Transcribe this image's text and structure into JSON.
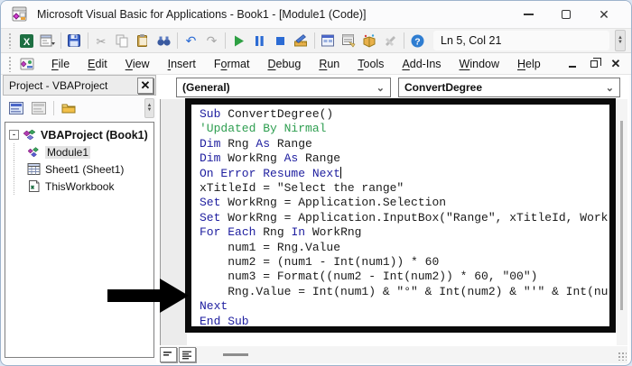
{
  "window": {
    "title": "Microsoft Visual Basic for Applications - Book1 - [Module1 (Code)]",
    "app_icon": "vba-app-icon",
    "controls": [
      "minimize",
      "maximize",
      "close"
    ]
  },
  "toolbar": {
    "icons": [
      "excel",
      "insert-userform",
      "save",
      "cut",
      "copy",
      "paste",
      "find",
      "undo",
      "redo",
      "run",
      "break",
      "reset",
      "design-mode",
      "project-explorer",
      "properties-window",
      "object-browser",
      "toolbox",
      "help"
    ],
    "separators_after": [
      "insert-userform",
      "save",
      "find",
      "redo",
      "design-mode",
      "toolbox"
    ],
    "status": "Ln 5, Col 21"
  },
  "menubar": {
    "window_icon": "module-window-icon",
    "items": [
      {
        "label": "File",
        "u": 0
      },
      {
        "label": "Edit",
        "u": 0
      },
      {
        "label": "View",
        "u": 0
      },
      {
        "label": "Insert",
        "u": 0
      },
      {
        "label": "Format",
        "u": 1
      },
      {
        "label": "Debug",
        "u": 0
      },
      {
        "label": "Run",
        "u": 0
      },
      {
        "label": "Tools",
        "u": 0
      },
      {
        "label": "Add-Ins",
        "u": 0
      },
      {
        "label": "Window",
        "u": 0
      },
      {
        "label": "Help",
        "u": 0
      }
    ],
    "mdi_controls": [
      "minimize",
      "restore",
      "close"
    ]
  },
  "project_panel": {
    "title": "Project - VBAProject",
    "toolbar_icons": [
      "view-code",
      "view-object",
      "toggle-folders"
    ],
    "tree": [
      {
        "label": "VBAProject (Book1)",
        "icon": "project-icon",
        "bold": true,
        "expander": "-",
        "indent": 0
      },
      {
        "label": "Module1",
        "icon": "module-icon",
        "selected": true,
        "indent": 1
      },
      {
        "label": "Sheet1 (Sheet1)",
        "icon": "sheet-icon",
        "indent": 1
      },
      {
        "label": "ThisWorkbook",
        "icon": "workbook-icon",
        "indent": 1
      }
    ]
  },
  "code_window": {
    "object_dropdown": "(General)",
    "procedure_dropdown": "ConvertDegree",
    "caret_line": 4,
    "code_lines": [
      [
        [
          "Sub",
          "k"
        ],
        [
          " ConvertDegree()",
          "t"
        ]
      ],
      [
        [
          "'Updated By Nirmal",
          "c"
        ]
      ],
      [
        [
          "Dim",
          "k"
        ],
        [
          " Rng ",
          "t"
        ],
        [
          "As",
          "k"
        ],
        [
          " Range",
          "t"
        ]
      ],
      [
        [
          "Dim",
          "k"
        ],
        [
          " WorkRng ",
          "t"
        ],
        [
          "As",
          "k"
        ],
        [
          " Range",
          "t"
        ]
      ],
      [
        [
          "On Error Resume Next",
          "k"
        ]
      ],
      [
        [
          "xTitleId = \"Select the range\"",
          "t"
        ]
      ],
      [
        [
          "Set",
          "k"
        ],
        [
          " WorkRng = Application.Selection",
          "t"
        ]
      ],
      [
        [
          "Set",
          "k"
        ],
        [
          " WorkRng = Application.InputBox(\"Range\", xTitleId, Work",
          "t"
        ]
      ],
      [
        [
          "For",
          "k"
        ],
        [
          " ",
          "t"
        ],
        [
          "Each",
          "k"
        ],
        [
          " Rng ",
          "t"
        ],
        [
          "In",
          "k"
        ],
        [
          " WorkRng",
          "t"
        ]
      ],
      [
        [
          "    num1 = Rng.Value",
          "t"
        ]
      ],
      [
        [
          "    num2 = (num1 - Int(num1)) * 60",
          "t"
        ]
      ],
      [
        [
          "    num3 = Format((num2 - Int(num2)) * 60, \"00\")",
          "t"
        ]
      ],
      [
        [
          "    Rng.Value = Int(num1) & \"°\" & Int(num2) & \"'\" & Int(nu",
          "t"
        ]
      ],
      [
        [
          "Next",
          "k"
        ]
      ],
      [
        [
          "End Sub",
          "k"
        ]
      ]
    ]
  },
  "colors": {
    "keyword": "#2020a0",
    "comment": "#2e9e50",
    "plain_text": "#1a1a1a",
    "annotation": "#000000",
    "excel_green": "#1d6f42",
    "run_green": "#2ea043",
    "break_blue": "#2b6bd4",
    "help_blue": "#2f7dd1"
  }
}
